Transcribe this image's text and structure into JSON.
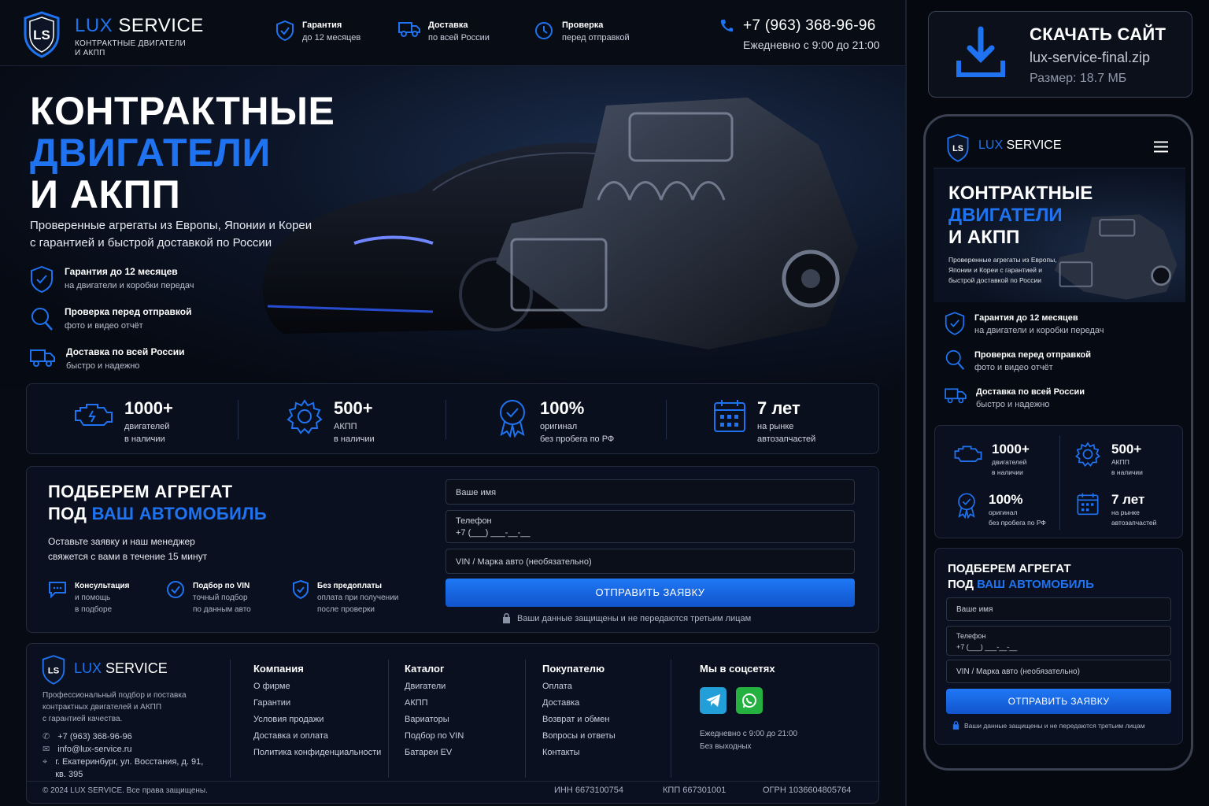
{
  "header": {
    "brand_a": "LUX",
    "brand_b": "SERVICE",
    "brand_sub1": "КОНТРАКТНЫЕ ДВИГАТЕЛИ",
    "brand_sub2": "И АКПП",
    "logo_letters": "LS",
    "features": [
      {
        "t1": "Гарантия",
        "t2": "до 12 месяцев",
        "icon": "shield-icon"
      },
      {
        "t1": "Доставка",
        "t2": "по всей России",
        "icon": "truck-icon"
      },
      {
        "t1": "Проверка",
        "t2": "перед отправкой",
        "icon": "clock-icon"
      }
    ],
    "phone": "+7 (963) 368-96-96",
    "hours": "Ежедневно с 9:00 до 21:00"
  },
  "hero": {
    "line1": "КОНТРАКТНЫЕ",
    "line2": "ДВИГАТЕЛИ",
    "line3": "И АКПП",
    "sub1": "Проверенные агрегаты из Европы, Японии и Кореи",
    "sub2": "с гарантией и быстрой доставкой по России",
    "features": [
      {
        "t1": "Гарантия до 12 месяцев",
        "t2": "на двигатели и коробки передач",
        "icon": "shield-icon"
      },
      {
        "t1": "Проверка перед отправкой",
        "t2": "фото и видео отчёт",
        "icon": "search-icon"
      },
      {
        "t1": "Доставка по всей России",
        "t2": "быстро и надежно",
        "icon": "truck-icon"
      }
    ]
  },
  "stats": [
    {
      "num": "1000+",
      "l1": "двигателей",
      "l2": "в наличии",
      "icon": "engine-icon"
    },
    {
      "num": "500+",
      "l1": "АКПП",
      "l2": "в наличии",
      "icon": "gear-icon"
    },
    {
      "num": "100%",
      "l1": "оригинал",
      "l2": "без пробега по РФ",
      "icon": "badge-icon"
    },
    {
      "num": "7 лет",
      "l1": "на рынке",
      "l2": "автозапчастей",
      "icon": "calendar-icon"
    }
  ],
  "form": {
    "title1": "ПОДБЕРЕМ АГРЕГАТ",
    "title2a": "ПОД",
    "title2b": "ВАШ АВТОМОБИЛЬ",
    "desc1": "Оставьте заявку и наш менеджер",
    "desc2": "свяжется с вами в течение 15 минут",
    "perks": [
      {
        "t1": "Консультация",
        "t2": "и помощь",
        "t3": "в подборе",
        "icon": "chat-icon"
      },
      {
        "t1": "Подбор по VIN",
        "t2": "точный подбор",
        "t3": "по данным авто",
        "icon": "check-circle-icon"
      },
      {
        "t1": "Без предоплаты",
        "t2": "оплата при получении",
        "t3": "после проверки",
        "icon": "shield-check-icon"
      }
    ],
    "name_placeholder": "Ваше имя",
    "phone_label": "Телефон",
    "phone_mask": "+7 (___) ___-__-__",
    "vin_placeholder": "VIN / Марка авто (необязательно)",
    "submit": "ОТПРАВИТЬ ЗАЯВКУ",
    "privacy": "Ваши данные защищены и не передаются третьим лицам"
  },
  "footer": {
    "about1": "Профессиональный подбор и поставка",
    "about2": "контрактных двигателей и АКПП",
    "about3": "с гарантией качества.",
    "phone": "+7 (963) 368-96-96",
    "email": "info@lux-service.ru",
    "addr1": "г. Екатеринбург, ул. Восстания, д. 91,",
    "addr2": "кв. 395",
    "cols": [
      {
        "title": "Компания",
        "items": [
          "О фирме",
          "Гарантии",
          "Условия продажи",
          "Доставка и оплата",
          "Политика конфиденциальности"
        ]
      },
      {
        "title": "Каталог",
        "items": [
          "Двигатели",
          "АКПП",
          "Вариаторы",
          "Подбор по VIN",
          "Батареи EV"
        ]
      },
      {
        "title": "Покупателю",
        "items": [
          "Оплата",
          "Доставка",
          "Возврат и обмен",
          "Вопросы и ответы",
          "Контакты"
        ]
      }
    ],
    "social_title": "Мы в соцсетях",
    "social_hours1": "Ежедневно с 9:00 до 21:00",
    "social_hours2": "Без выходных",
    "copyright": "© 2024 LUX SERVICE. Все права защищены.",
    "inn": "ИНН 6673100754",
    "kpp": "КПП 667301001",
    "ogrn": "ОГРН 1036604805764"
  },
  "download": {
    "title": "СКАЧАТЬ САЙТ",
    "file": "lux-service-final.zip",
    "size": "Размер: 18.7 МБ"
  },
  "colors": {
    "accent": "#1f73f0",
    "bg": "#070b14",
    "panel": "#0b1020"
  }
}
